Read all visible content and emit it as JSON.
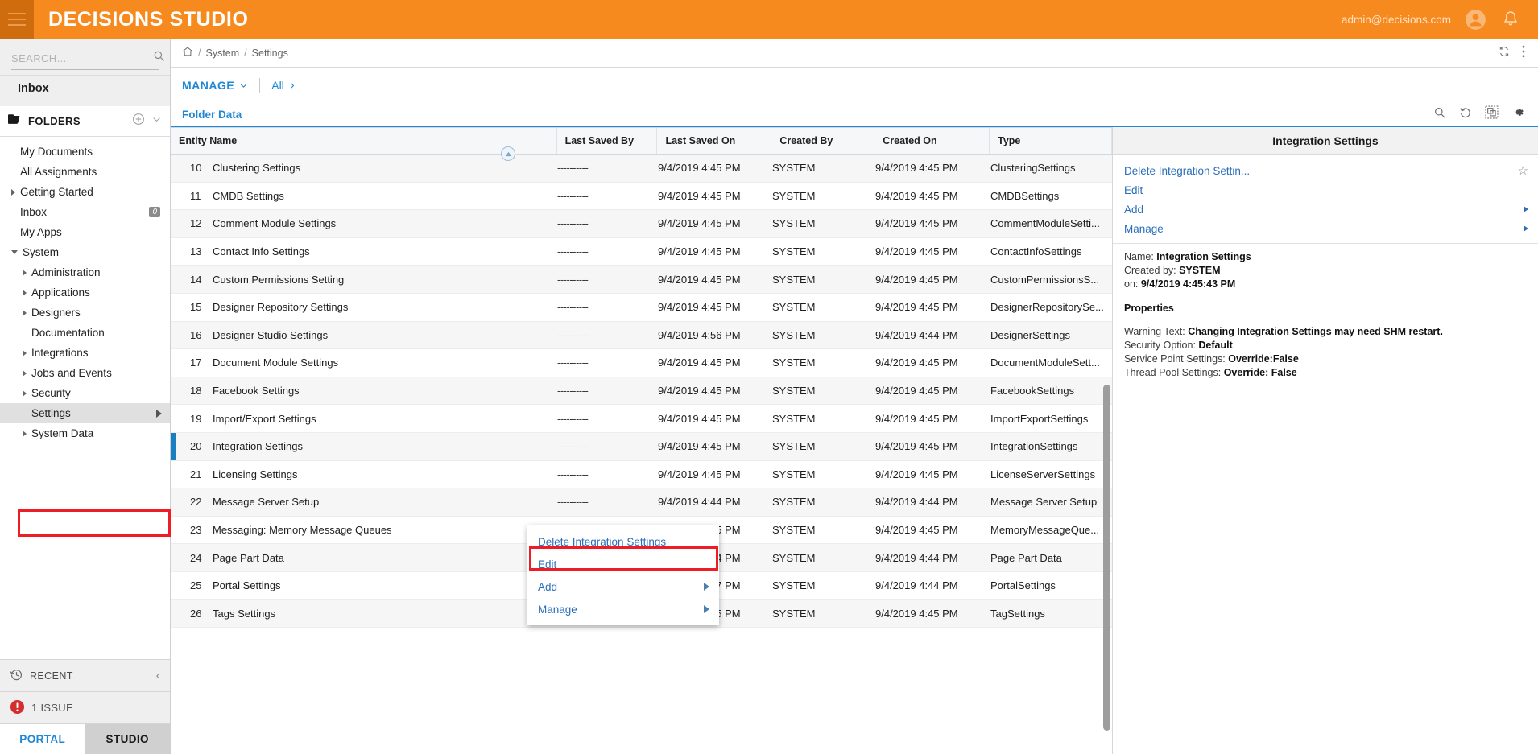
{
  "topbar": {
    "app_title": "DECISIONS STUDIO",
    "user_email": "admin@decisions.com",
    "menu_icon": "hamburger-icon",
    "account_icon": "user-avatar-icon",
    "bell_icon": "notification-bell-icon",
    "background_color": "#f78a1e"
  },
  "sidebar": {
    "search": {
      "placeholder": "SEARCH...",
      "value": "",
      "icon": "search-icon"
    },
    "inbox_shortcut": "Inbox",
    "folders_header": {
      "label": "FOLDERS",
      "folder_icon": "folder-icon",
      "add_icon": "plus-circle-icon",
      "collapse_icon": "chevron-down-icon"
    },
    "items": [
      {
        "label": "My Documents",
        "indent": 1,
        "arrow": "none",
        "badge": ""
      },
      {
        "label": "All Assignments",
        "indent": 1,
        "arrow": "none",
        "badge": ""
      },
      {
        "label": "Getting Started",
        "indent": 1,
        "arrow": "closed",
        "badge": ""
      },
      {
        "label": "Inbox",
        "indent": 1,
        "arrow": "none",
        "badge": "0"
      },
      {
        "label": "My Apps",
        "indent": 1,
        "arrow": "none",
        "badge": ""
      },
      {
        "label": "System",
        "indent": 1,
        "arrow": "open",
        "badge": ""
      },
      {
        "label": "Administration",
        "indent": 2,
        "arrow": "closed",
        "badge": ""
      },
      {
        "label": "Applications",
        "indent": 2,
        "arrow": "closed",
        "badge": ""
      },
      {
        "label": "Designers",
        "indent": 2,
        "arrow": "closed",
        "badge": ""
      },
      {
        "label": "Documentation",
        "indent": 2,
        "arrow": "none",
        "badge": ""
      },
      {
        "label": "Integrations",
        "indent": 2,
        "arrow": "closed",
        "badge": ""
      },
      {
        "label": "Jobs and Events",
        "indent": 2,
        "arrow": "closed",
        "badge": ""
      },
      {
        "label": "Security",
        "indent": 2,
        "arrow": "closed",
        "badge": ""
      },
      {
        "label": "Settings",
        "indent": 2,
        "arrow": "none",
        "badge": "",
        "selected": true,
        "submenu_arrow": true
      },
      {
        "label": "System Data",
        "indent": 2,
        "arrow": "closed",
        "badge": ""
      }
    ],
    "recent": {
      "label": "RECENT",
      "icon": "history-clock-icon",
      "collapse_icon": "chevron-left-icon"
    },
    "issues": {
      "label": "1 ISSUE",
      "icon": "error-exclamation-icon",
      "color": "#d32f2f"
    },
    "tabs": [
      {
        "label": "PORTAL",
        "active": true
      },
      {
        "label": "STUDIO",
        "active": false
      }
    ]
  },
  "main": {
    "breadcrumb": {
      "home_icon": "home-icon",
      "crumbs": [
        "System",
        "Settings"
      ],
      "refresh_icon": "refresh-icon",
      "overflow_icon": "kebab-menu-icon"
    },
    "manage_bar": {
      "manage_label": "MANAGE",
      "manage_caret": "chevron-down-icon",
      "all_label": "All",
      "all_caret": "chevron-right-icon"
    },
    "folder_data": {
      "title": "Folder Data",
      "icons": [
        "search-icon",
        "refresh-counterclockwise-icon",
        "duplicate-icon",
        "gear-icon"
      ]
    }
  },
  "table": {
    "columns": [
      "Entity Name",
      "Last Saved By",
      "Last Saved On",
      "Created By",
      "Created On",
      "Type"
    ],
    "collapse_icon": "caret-up-circle-icon",
    "rows": [
      {
        "idx": "10",
        "name": "Clustering Settings",
        "saved_by": "----------",
        "saved_on": "9/4/2019 4:45 PM",
        "created_by": "SYSTEM",
        "created_on": "9/4/2019 4:45 PM",
        "type": "ClusteringSettings"
      },
      {
        "idx": "11",
        "name": "CMDB Settings",
        "saved_by": "----------",
        "saved_on": "9/4/2019 4:45 PM",
        "created_by": "SYSTEM",
        "created_on": "9/4/2019 4:45 PM",
        "type": "CMDBSettings"
      },
      {
        "idx": "12",
        "name": "Comment Module Settings",
        "saved_by": "----------",
        "saved_on": "9/4/2019 4:45 PM",
        "created_by": "SYSTEM",
        "created_on": "9/4/2019 4:45 PM",
        "type": "CommentModuleSetti..."
      },
      {
        "idx": "13",
        "name": "Contact Info Settings",
        "saved_by": "----------",
        "saved_on": "9/4/2019 4:45 PM",
        "created_by": "SYSTEM",
        "created_on": "9/4/2019 4:45 PM",
        "type": "ContactInfoSettings"
      },
      {
        "idx": "14",
        "name": "Custom Permissions Setting",
        "saved_by": "----------",
        "saved_on": "9/4/2019 4:45 PM",
        "created_by": "SYSTEM",
        "created_on": "9/4/2019 4:45 PM",
        "type": "CustomPermissionsS..."
      },
      {
        "idx": "15",
        "name": "Designer Repository Settings",
        "saved_by": "----------",
        "saved_on": "9/4/2019 4:45 PM",
        "created_by": "SYSTEM",
        "created_on": "9/4/2019 4:45 PM",
        "type": "DesignerRepositorySe..."
      },
      {
        "idx": "16",
        "name": "Designer Studio Settings",
        "saved_by": "----------",
        "saved_on": "9/4/2019 4:56 PM",
        "created_by": "SYSTEM",
        "created_on": "9/4/2019 4:44 PM",
        "type": "DesignerSettings"
      },
      {
        "idx": "17",
        "name": "Document Module Settings",
        "saved_by": "----------",
        "saved_on": "9/4/2019 4:45 PM",
        "created_by": "SYSTEM",
        "created_on": "9/4/2019 4:45 PM",
        "type": "DocumentModuleSett..."
      },
      {
        "idx": "18",
        "name": "Facebook Settings",
        "saved_by": "----------",
        "saved_on": "9/4/2019 4:45 PM",
        "created_by": "SYSTEM",
        "created_on": "9/4/2019 4:45 PM",
        "type": "FacebookSettings"
      },
      {
        "idx": "19",
        "name": "Import/Export Settings",
        "saved_by": "----------",
        "saved_on": "9/4/2019 4:45 PM",
        "created_by": "SYSTEM",
        "created_on": "9/4/2019 4:45 PM",
        "type": "ImportExportSettings"
      },
      {
        "idx": "20",
        "name": "Integration Settings",
        "saved_by": "----------",
        "saved_on": "9/4/2019 4:45 PM",
        "created_by": "SYSTEM",
        "created_on": "9/4/2019 4:45 PM",
        "type": "IntegrationSettings",
        "selected": true
      },
      {
        "idx": "21",
        "name": "Licensing Settings",
        "saved_by": "----------",
        "saved_on": "9/4/2019 4:45 PM",
        "created_by": "SYSTEM",
        "created_on": "9/4/2019 4:45 PM",
        "type": "LicenseServerSettings"
      },
      {
        "idx": "22",
        "name": "Message Server Setup",
        "saved_by": "----------",
        "saved_on": "9/4/2019 4:44 PM",
        "created_by": "SYSTEM",
        "created_on": "9/4/2019 4:44 PM",
        "type": "Message Server Setup"
      },
      {
        "idx": "23",
        "name": "Messaging: Memory Message Queues",
        "saved_by": "----------",
        "saved_on": "9/4/2019 4:45 PM",
        "created_by": "SYSTEM",
        "created_on": "9/4/2019 4:45 PM",
        "type": "MemoryMessageQue..."
      },
      {
        "idx": "24",
        "name": "Page Part Data",
        "saved_by": "----------",
        "saved_on": "9/4/2019 4:44 PM",
        "created_by": "SYSTEM",
        "created_on": "9/4/2019 4:44 PM",
        "type": "Page Part Data"
      },
      {
        "idx": "25",
        "name": "Portal Settings",
        "saved_by": "----------",
        "saved_on": "9/4/2019 4:57 PM",
        "created_by": "SYSTEM",
        "created_on": "9/4/2019 4:44 PM",
        "type": "PortalSettings"
      },
      {
        "idx": "26",
        "name": "Tags Settings",
        "saved_by": "----------",
        "saved_on": "9/4/2019 4:45 PM",
        "created_by": "SYSTEM",
        "created_on": "9/4/2019 4:45 PM",
        "type": "TagSettings"
      }
    ]
  },
  "context_menu": {
    "items": [
      {
        "label": "Delete Integration Settings",
        "submenu": false
      },
      {
        "label": "Edit",
        "submenu": false,
        "highlighted": true
      },
      {
        "label": "Add",
        "submenu": true
      },
      {
        "label": "Manage",
        "submenu": true
      }
    ]
  },
  "right_panel": {
    "title": "Integration Settings",
    "actions": [
      {
        "label": "Delete Integration Settin...",
        "star_icon": "star-outline-icon",
        "submenu": false
      },
      {
        "label": "Edit",
        "submenu": false
      },
      {
        "label": "Add",
        "submenu": true
      },
      {
        "label": "Manage",
        "submenu": true
      }
    ],
    "meta": {
      "name_label": "Name: ",
      "name_value": "Integration Settings",
      "created_by_label": "Created by: ",
      "created_by_value": "SYSTEM",
      "on_label": "on: ",
      "on_value": "9/4/2019 4:45:43 PM"
    },
    "properties_title": "Properties",
    "properties": [
      {
        "label": "Warning Text: ",
        "value": "Changing Integration Settings may need SHM restart."
      },
      {
        "label": "Security Option: ",
        "value": "Default"
      },
      {
        "label": "Service Point Settings: ",
        "value": "Override:False"
      },
      {
        "label": "Thread Pool Settings: ",
        "value": "Override: False"
      }
    ]
  },
  "annotations": {
    "highlight_color": "#ee1c25",
    "settings_box": "sidebar Settings row",
    "edit_box": "context menu Edit item"
  }
}
